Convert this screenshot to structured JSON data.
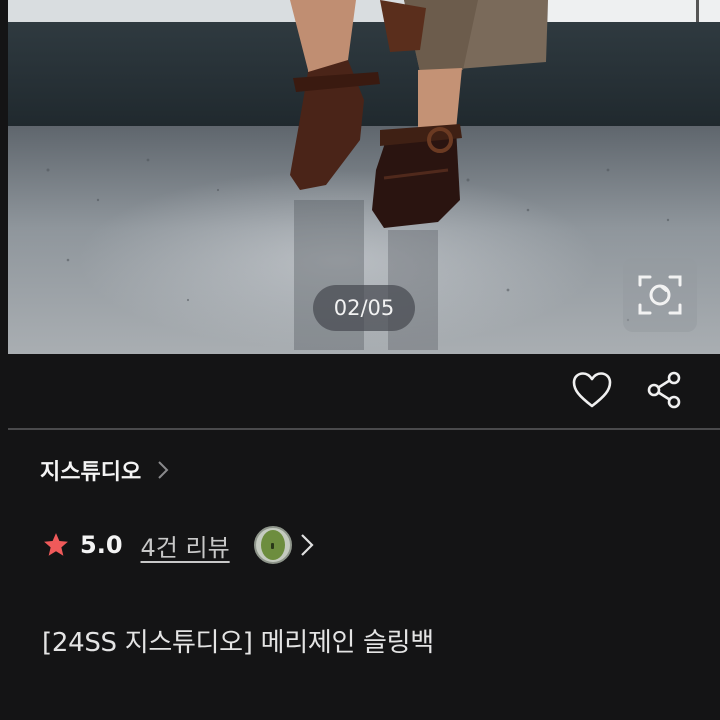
{
  "gallery": {
    "counter": "02/05",
    "zoom_icon": "camera-lens-icon"
  },
  "actions": {
    "like_icon": "heart-icon",
    "share_icon": "share-icon"
  },
  "store": {
    "name": "지스튜디오"
  },
  "rating": {
    "score": "5.0",
    "reviews_label": "4건 리뷰",
    "star_color": "#f05a5a"
  },
  "product": {
    "title": "[24SS 지스튜디오] 메리제인 슬링백"
  }
}
